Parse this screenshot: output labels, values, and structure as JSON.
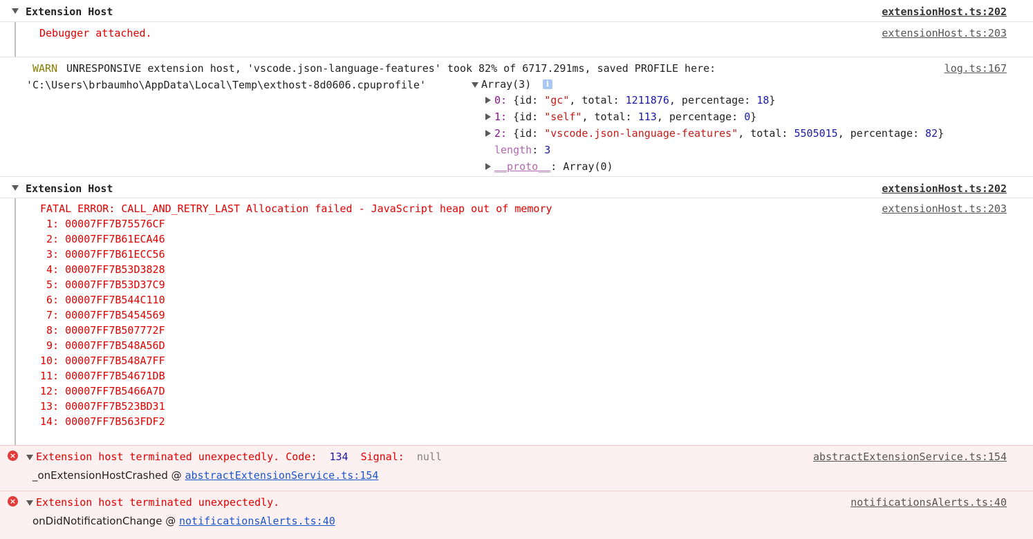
{
  "groups": [
    {
      "title": "Extension Host",
      "source": "extensionHost.ts:202",
      "message": "Debugger attached.",
      "message_source": "extensionHost.ts:203"
    },
    {
      "title": "Extension Host",
      "source": "extensionHost.ts:202",
      "message": "FATAL ERROR: CALL_AND_RETRY_LAST Allocation failed - JavaScript heap out of memory",
      "message_source": "extensionHost.ts:203"
    }
  ],
  "warn": {
    "label": "WARN",
    "text": "UNRESPONSIVE extension host, 'vscode.json-language-features' took 82% of 6717.291ms, saved PROFILE here:",
    "path": "'C:\\Users\\brbaumho\\AppData\\Local\\Temp\\exthost-8d0606.cpuprofile'",
    "source": "log.ts:167",
    "array_label": "Array(3)",
    "info_icon": "info-icon",
    "items": [
      {
        "index": "0",
        "id": "\"gc\"",
        "total": "1211876",
        "percentage": "18"
      },
      {
        "index": "1",
        "id": "\"self\"",
        "total": "113",
        "percentage": "0"
      },
      {
        "index": "2",
        "id": "\"vscode.json-language-features\"",
        "total": "5505015",
        "percentage": "82"
      }
    ],
    "length_label": "length",
    "length_value": "3",
    "proto_label": "__proto__",
    "proto_value": "Array(0)"
  },
  "stack_lines": [
    " 1: 00007FF7B75576CF",
    " 2: 00007FF7B61ECA46",
    " 3: 00007FF7B61ECC56",
    " 4: 00007FF7B53D3828",
    " 5: 00007FF7B53D37C9",
    " 6: 00007FF7B544C110",
    " 7: 00007FF7B5454569",
    " 8: 00007FF7B507772F",
    " 9: 00007FF7B548A56D",
    "10: 00007FF7B548A7FF",
    "11: 00007FF7B54671DB",
    "12: 00007FF7B5466A7D",
    "13: 00007FF7B523BD31",
    "14: 00007FF7B563FDF2"
  ],
  "errors": [
    {
      "message": "Extension host terminated unexpectedly. Code:",
      "code": "134",
      "signal_label": "Signal:",
      "signal_value": "null",
      "source": "abstractExtensionService.ts:154",
      "caller": "_onExtensionHostCrashed",
      "at": "@",
      "caller_link": "abstractExtensionService.ts:154"
    },
    {
      "message": "Extension host terminated unexpectedly.",
      "source": "notificationsAlerts.ts:40",
      "caller": "onDidNotificationChange",
      "at": "@",
      "caller_link": "notificationsAlerts.ts:40"
    }
  ],
  "colors": {
    "error_text": "#e00000",
    "error_row_bg": "#fdf0f0",
    "link": "#1a56c9",
    "warn_label": "#8a7b00"
  }
}
